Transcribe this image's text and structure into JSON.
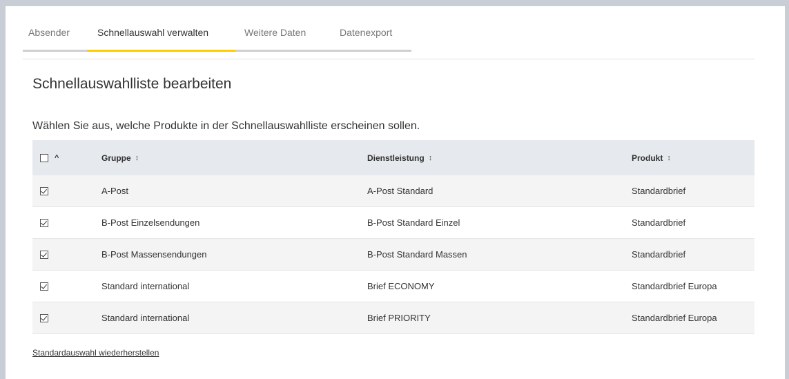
{
  "tabs": [
    {
      "label": "Absender",
      "active": false
    },
    {
      "label": "Schnellauswahl verwalten",
      "active": true
    },
    {
      "label": "Weitere Daten",
      "active": false
    },
    {
      "label": "Datenexport",
      "active": false
    }
  ],
  "section": {
    "title": "Schnellauswahlliste bearbeiten",
    "instruction": "Wählen Sie aus, welche Produkte in der Schnellauswahlliste erscheinen sollen."
  },
  "table": {
    "select_all_checked": false,
    "columns": {
      "gruppe": "Gruppe",
      "dienstleistung": "Dienstleistung",
      "produkt": "Produkt"
    },
    "rows": [
      {
        "checked": true,
        "gruppe": "A-Post",
        "dienstleistung": "A-Post Standard",
        "produkt": "Standardbrief"
      },
      {
        "checked": true,
        "gruppe": "B-Post Einzelsendungen",
        "dienstleistung": "B-Post Standard Einzel",
        "produkt": "Standardbrief"
      },
      {
        "checked": true,
        "gruppe": "B-Post Massensendungen",
        "dienstleistung": "B-Post Standard Massen",
        "produkt": "Standardbrief"
      },
      {
        "checked": true,
        "gruppe": "Standard international",
        "dienstleistung": "Brief ECONOMY",
        "produkt": "Standardbrief Europa"
      },
      {
        "checked": true,
        "gruppe": "Standard international",
        "dienstleistung": "Brief PRIORITY",
        "produkt": "Standardbrief Europa"
      }
    ]
  },
  "restore_link": "Standardauswahl wiederherstellen",
  "icons": {
    "sort": "sort-updown-icon",
    "caret": "caret-up-icon",
    "checkbox": "checkbox-icon"
  },
  "colors": {
    "active_tab_accent": "#ffcc00",
    "header_background": "#e6e9ed",
    "page_frame": "#c9cdd6"
  }
}
